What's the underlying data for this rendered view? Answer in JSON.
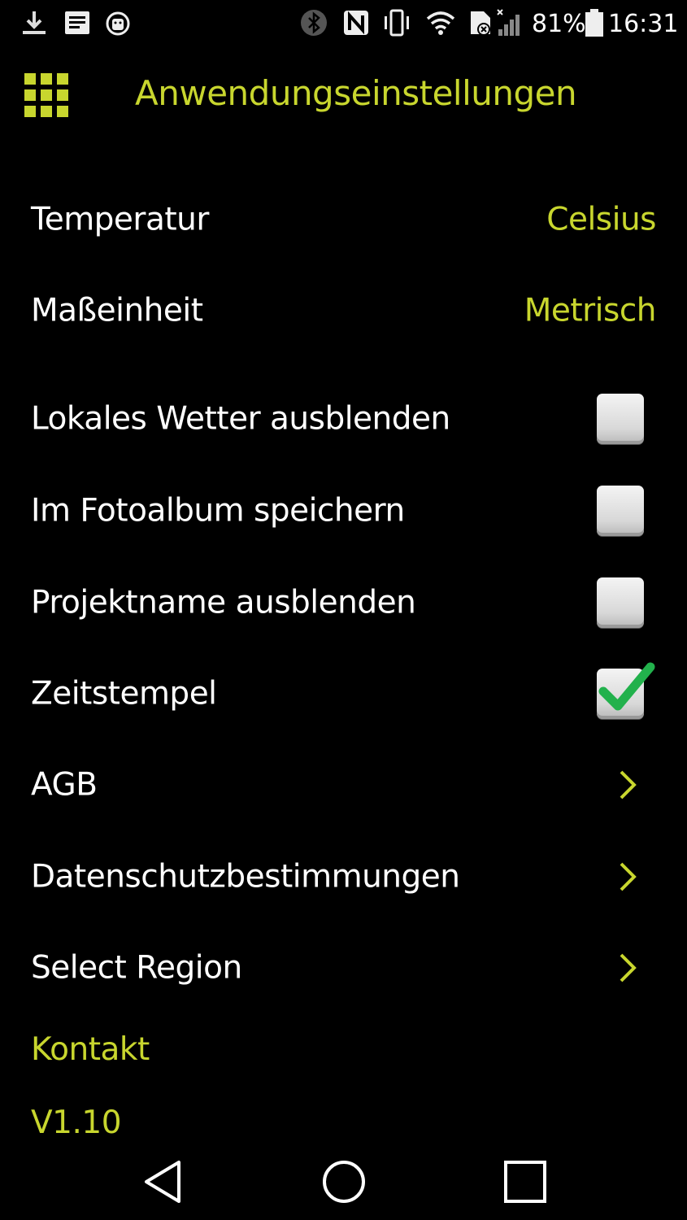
{
  "status_bar": {
    "battery_percent": "81%",
    "time": "16:31",
    "icons": [
      "download-icon",
      "notes-icon",
      "android-debug-icon",
      "bluetooth-icon",
      "nfc-icon",
      "vibrate-icon",
      "wifi-icon",
      "sd-card-icon",
      "signal-icon",
      "battery-icon"
    ]
  },
  "header": {
    "title": "Anwendungseinstellungen",
    "menu_icon": "grid-menu-icon"
  },
  "settings": {
    "temperature": {
      "label": "Temperatur",
      "value": "Celsius"
    },
    "units": {
      "label": "Maßeinheit",
      "value": "Metrisch"
    },
    "hide_local_weather": {
      "label": "Lokales Wetter ausblenden",
      "checked": false
    },
    "save_to_album": {
      "label": "Im Fotoalbum speichern",
      "checked": false
    },
    "hide_project_name": {
      "label": "Projektname ausblenden",
      "checked": false
    },
    "timestamp": {
      "label": "Zeitstempel",
      "checked": true
    },
    "terms": {
      "label": "AGB"
    },
    "privacy": {
      "label": "Datenschutzbestimmungen"
    },
    "region": {
      "label": "Select Region"
    }
  },
  "footer": {
    "contact": "Kontakt",
    "version": "V1.10"
  },
  "colors": {
    "accent": "#c8d62e",
    "background": "#000000",
    "text": "#ffffff",
    "check_green": "#22b14c"
  }
}
